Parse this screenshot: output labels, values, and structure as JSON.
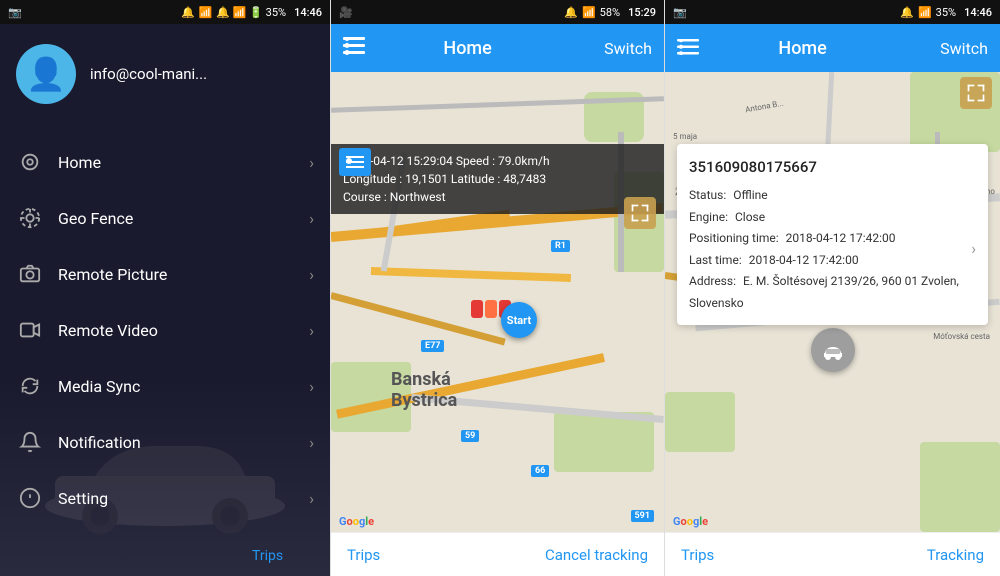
{
  "panel1": {
    "status_bar": {
      "left": "📷",
      "time": "14:46",
      "icons": "🔔 📶 🔋 35%"
    },
    "profile": {
      "email": "info@cool-mani...",
      "avatar_icon": "👤"
    },
    "nav_items": [
      {
        "id": "home",
        "label": "Home",
        "icon": "⊙"
      },
      {
        "id": "geo-fence",
        "label": "Geo Fence",
        "icon": "⚙"
      },
      {
        "id": "remote-picture",
        "label": "Remote Picture",
        "icon": "📷"
      },
      {
        "id": "remote-video",
        "label": "Remote Video",
        "icon": "🎬"
      },
      {
        "id": "media-sync",
        "label": "Media Sync",
        "icon": "↻"
      },
      {
        "id": "notification",
        "label": "Notification",
        "icon": "🔔"
      },
      {
        "id": "setting",
        "label": "Setting",
        "icon": "ℹ"
      }
    ],
    "trips_label": "Trips"
  },
  "panel2": {
    "status_bar": {
      "left": "🎥",
      "time": "15:29",
      "battery": "58%"
    },
    "header": {
      "title": "Home",
      "switch_label": "Switch",
      "menu_icon": "☰"
    },
    "info_bar": {
      "line1": "2018-04-12 15:29:04  Speed : 79.0km/h",
      "line2": "Longitude : 19,1501  Latitude : 48,7483",
      "line3": "Course : Northwest"
    },
    "map": {
      "city_label_line1": "Banská",
      "city_label_line2": "Bystrica",
      "google_label": "Google",
      "marker_label": "Start"
    },
    "footer": {
      "trips_label": "Trips",
      "cancel_label": "Cancel tracking"
    }
  },
  "panel3": {
    "status_bar": {
      "left": "📷",
      "time": "14:46",
      "battery": "35%"
    },
    "header": {
      "title": "Home",
      "switch_label": "Switch",
      "menu_icon": "☰"
    },
    "device_card": {
      "device_id": "351609080175667",
      "status_label": "Status:",
      "status_value": "Offline",
      "engine_label": "Engine:",
      "engine_value": "Close",
      "positioning_label": "Positioning time:",
      "positioning_value": "2018-04-12 17:42:00",
      "last_time_label": "Last time:",
      "last_time_value": "2018-04-12 17:42:00",
      "address_label": "Address:",
      "address_value": "E. M. Šoltésovej\n2139/26, 960 01 Zvolen, Slovensko"
    },
    "map": {
      "google_label": "Google"
    },
    "footer": {
      "trips_label": "Trips",
      "tracking_label": "Tracking"
    }
  }
}
